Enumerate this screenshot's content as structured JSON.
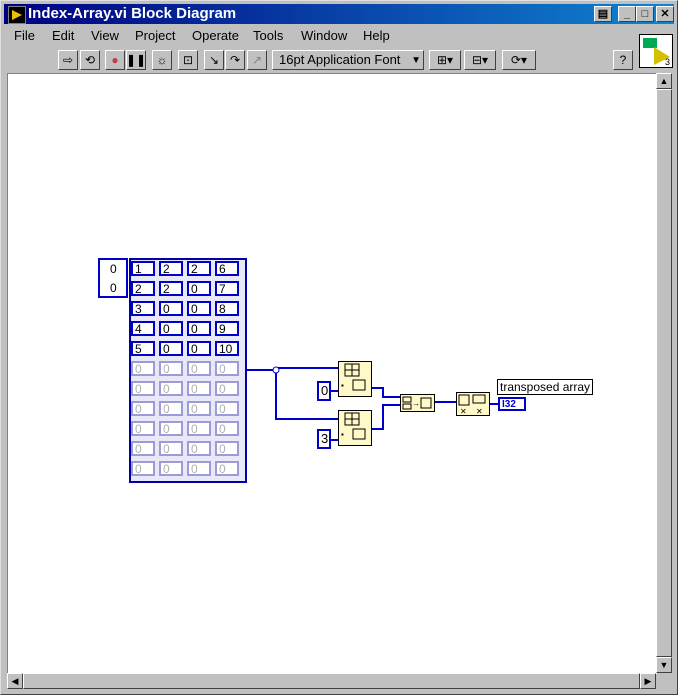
{
  "window": {
    "title": "Index-Array.vi Block Diagram"
  },
  "menu": [
    {
      "label": "File"
    },
    {
      "label": "Edit"
    },
    {
      "label": "View"
    },
    {
      "label": "Project"
    },
    {
      "label": "Operate"
    },
    {
      "label": "Tools"
    },
    {
      "label": "Window"
    },
    {
      "label": "Help"
    }
  ],
  "toolbar": {
    "font": "16pt Application Font",
    "help": "?"
  },
  "vi_icon": {
    "count": "3"
  },
  "diagram": {
    "index_values": [
      "0",
      "0"
    ],
    "array_rows": [
      [
        "1",
        "2",
        "2",
        "6"
      ],
      [
        "2",
        "2",
        "0",
        "7"
      ],
      [
        "3",
        "0",
        "0",
        "8"
      ],
      [
        "4",
        "0",
        "0",
        "9"
      ],
      [
        "5",
        "0",
        "0",
        "10"
      ],
      [
        "0",
        "0",
        "0",
        "0"
      ],
      [
        "0",
        "0",
        "0",
        "0"
      ],
      [
        "0",
        "0",
        "0",
        "0"
      ],
      [
        "0",
        "0",
        "0",
        "0"
      ],
      [
        "0",
        "0",
        "0",
        "0"
      ],
      [
        "0",
        "0",
        "0",
        "0"
      ]
    ],
    "const_top": "0",
    "const_bottom": "3",
    "indicator_label": "transposed array",
    "indicator_type": "I32"
  },
  "colors": {
    "title_start": "#000080",
    "title_end": "#1084d0",
    "wire": "#0000cc"
  }
}
